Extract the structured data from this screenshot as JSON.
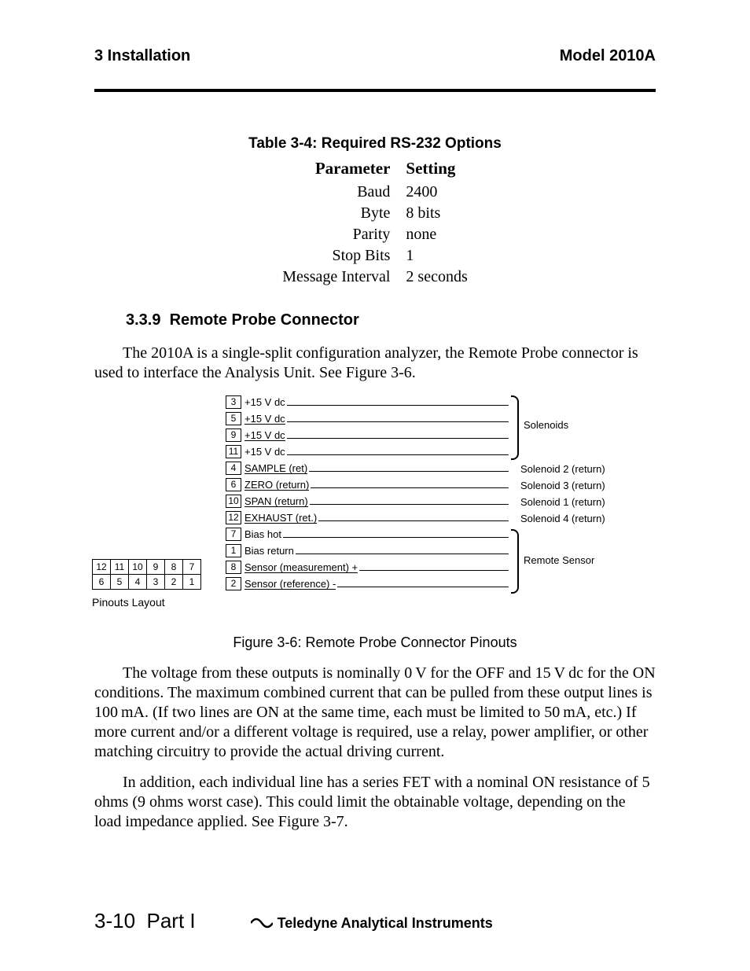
{
  "header": {
    "left": "3  Installation",
    "right": "Model 2010A"
  },
  "table": {
    "caption": "Table 3-4: Required RS-232 Options",
    "columns": [
      "Parameter",
      "Setting"
    ],
    "rows": [
      {
        "param": "Baud",
        "setting": "2400"
      },
      {
        "param": "Byte",
        "setting": "8 bits"
      },
      {
        "param": "Parity",
        "setting": "none"
      },
      {
        "param": "Stop Bits",
        "setting": "1"
      },
      {
        "param": "Message Interval",
        "setting": "2 seconds"
      }
    ]
  },
  "section": {
    "number": "3.3.9",
    "title": "Remote Probe Connector"
  },
  "p1": "The 2010A is a single-split configuration analyzer, the Remote Probe connector is used to interface the Analysis Unit. See Figure 3-6.",
  "figure": {
    "pins": [
      {
        "num": "3",
        "label": "+15 V dc",
        "underline": false
      },
      {
        "num": "5",
        "label": "+15 V dc",
        "underline": true
      },
      {
        "num": "9",
        "label": "+15 V dc",
        "underline": true
      },
      {
        "num": "11",
        "label": "+15 V dc",
        "underline": false
      },
      {
        "num": "4",
        "label": "SAMPLE (ret)",
        "underline": true
      },
      {
        "num": "6",
        "label": "ZERO (return)",
        "underline": true
      },
      {
        "num": "10",
        "label": "SPAN (return)",
        "underline": true
      },
      {
        "num": "12",
        "label": "EXHAUST (ret.)",
        "underline": true
      },
      {
        "num": "7",
        "label": "Bias hot",
        "underline": false
      },
      {
        "num": "1",
        "label": "Bias return",
        "underline": false
      },
      {
        "num": "8",
        "label": "Sensor (measurement) +",
        "underline": true
      },
      {
        "num": "2",
        "label": "Sensor (reference) -",
        "underline": true
      }
    ],
    "groups": {
      "solenoids": "Solenoids",
      "sol2": "Solenoid 2 (return)",
      "sol3": "Solenoid 3 (return)",
      "sol1": "Solenoid 1 (return)",
      "sol4": "Solenoid 4 (return)",
      "remote": "Remote Sensor"
    },
    "pinout_layout_rows": [
      [
        "12",
        "11",
        "10",
        "9",
        "8",
        "7"
      ],
      [
        "6",
        "5",
        "4",
        "3",
        "2",
        "1"
      ]
    ],
    "pinout_caption": "Pinouts Layout",
    "caption": "Figure 3-6: Remote Probe Connector Pinouts"
  },
  "p2": "The voltage from these outputs is nominally 0 V for the OFF and 15 V dc for the ON conditions. The maximum combined current that can be pulled from these output lines is 100 mA. (If two lines are ON at the same time, each must be limited to 50 mA, etc.) If more current and/or a different voltage is required, use a relay, power amplifier, or other matching circuitry to provide the actual driving current.",
  "p3": "In addition, each individual line has a series FET with a nominal ON resistance of 5 ohms (9 ohms worst case). This could limit the obtainable voltage, depending on the load impedance applied. See Figure 3-7.",
  "footer": {
    "page": "3-10",
    "part": "Part I",
    "brand": "Teledyne Analytical Instruments"
  }
}
